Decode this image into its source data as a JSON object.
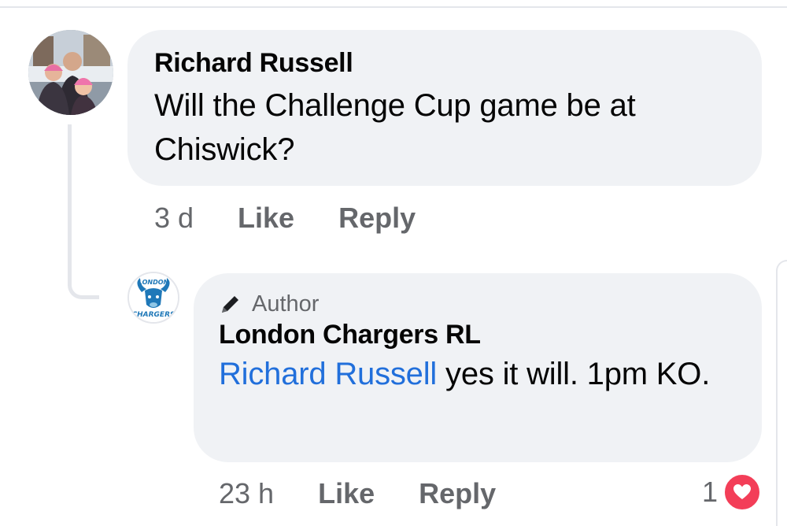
{
  "comments": [
    {
      "author": "Richard Russell",
      "text": "Will the Challenge Cup game be at Chiswick?",
      "time": "3 d",
      "like_label": "Like",
      "reply_label": "Reply"
    }
  ],
  "reply": {
    "badge": "Author",
    "author": "London Chargers RL",
    "mention": "Richard Russell",
    "text": " yes it will. 1pm KO.",
    "time": "23 h",
    "like_label": "Like",
    "reply_label": "Reply",
    "reaction_count": "1",
    "reaction_icon": "heart-icon",
    "logo_text_top": "LONDON",
    "logo_text_bottom": "CHARGERS"
  },
  "colors": {
    "bubble_bg": "#f0f2f5",
    "mention": "#216fdb",
    "meta_text": "#65676b",
    "heart": "#f33e58",
    "logo_blue": "#1f78b8"
  }
}
